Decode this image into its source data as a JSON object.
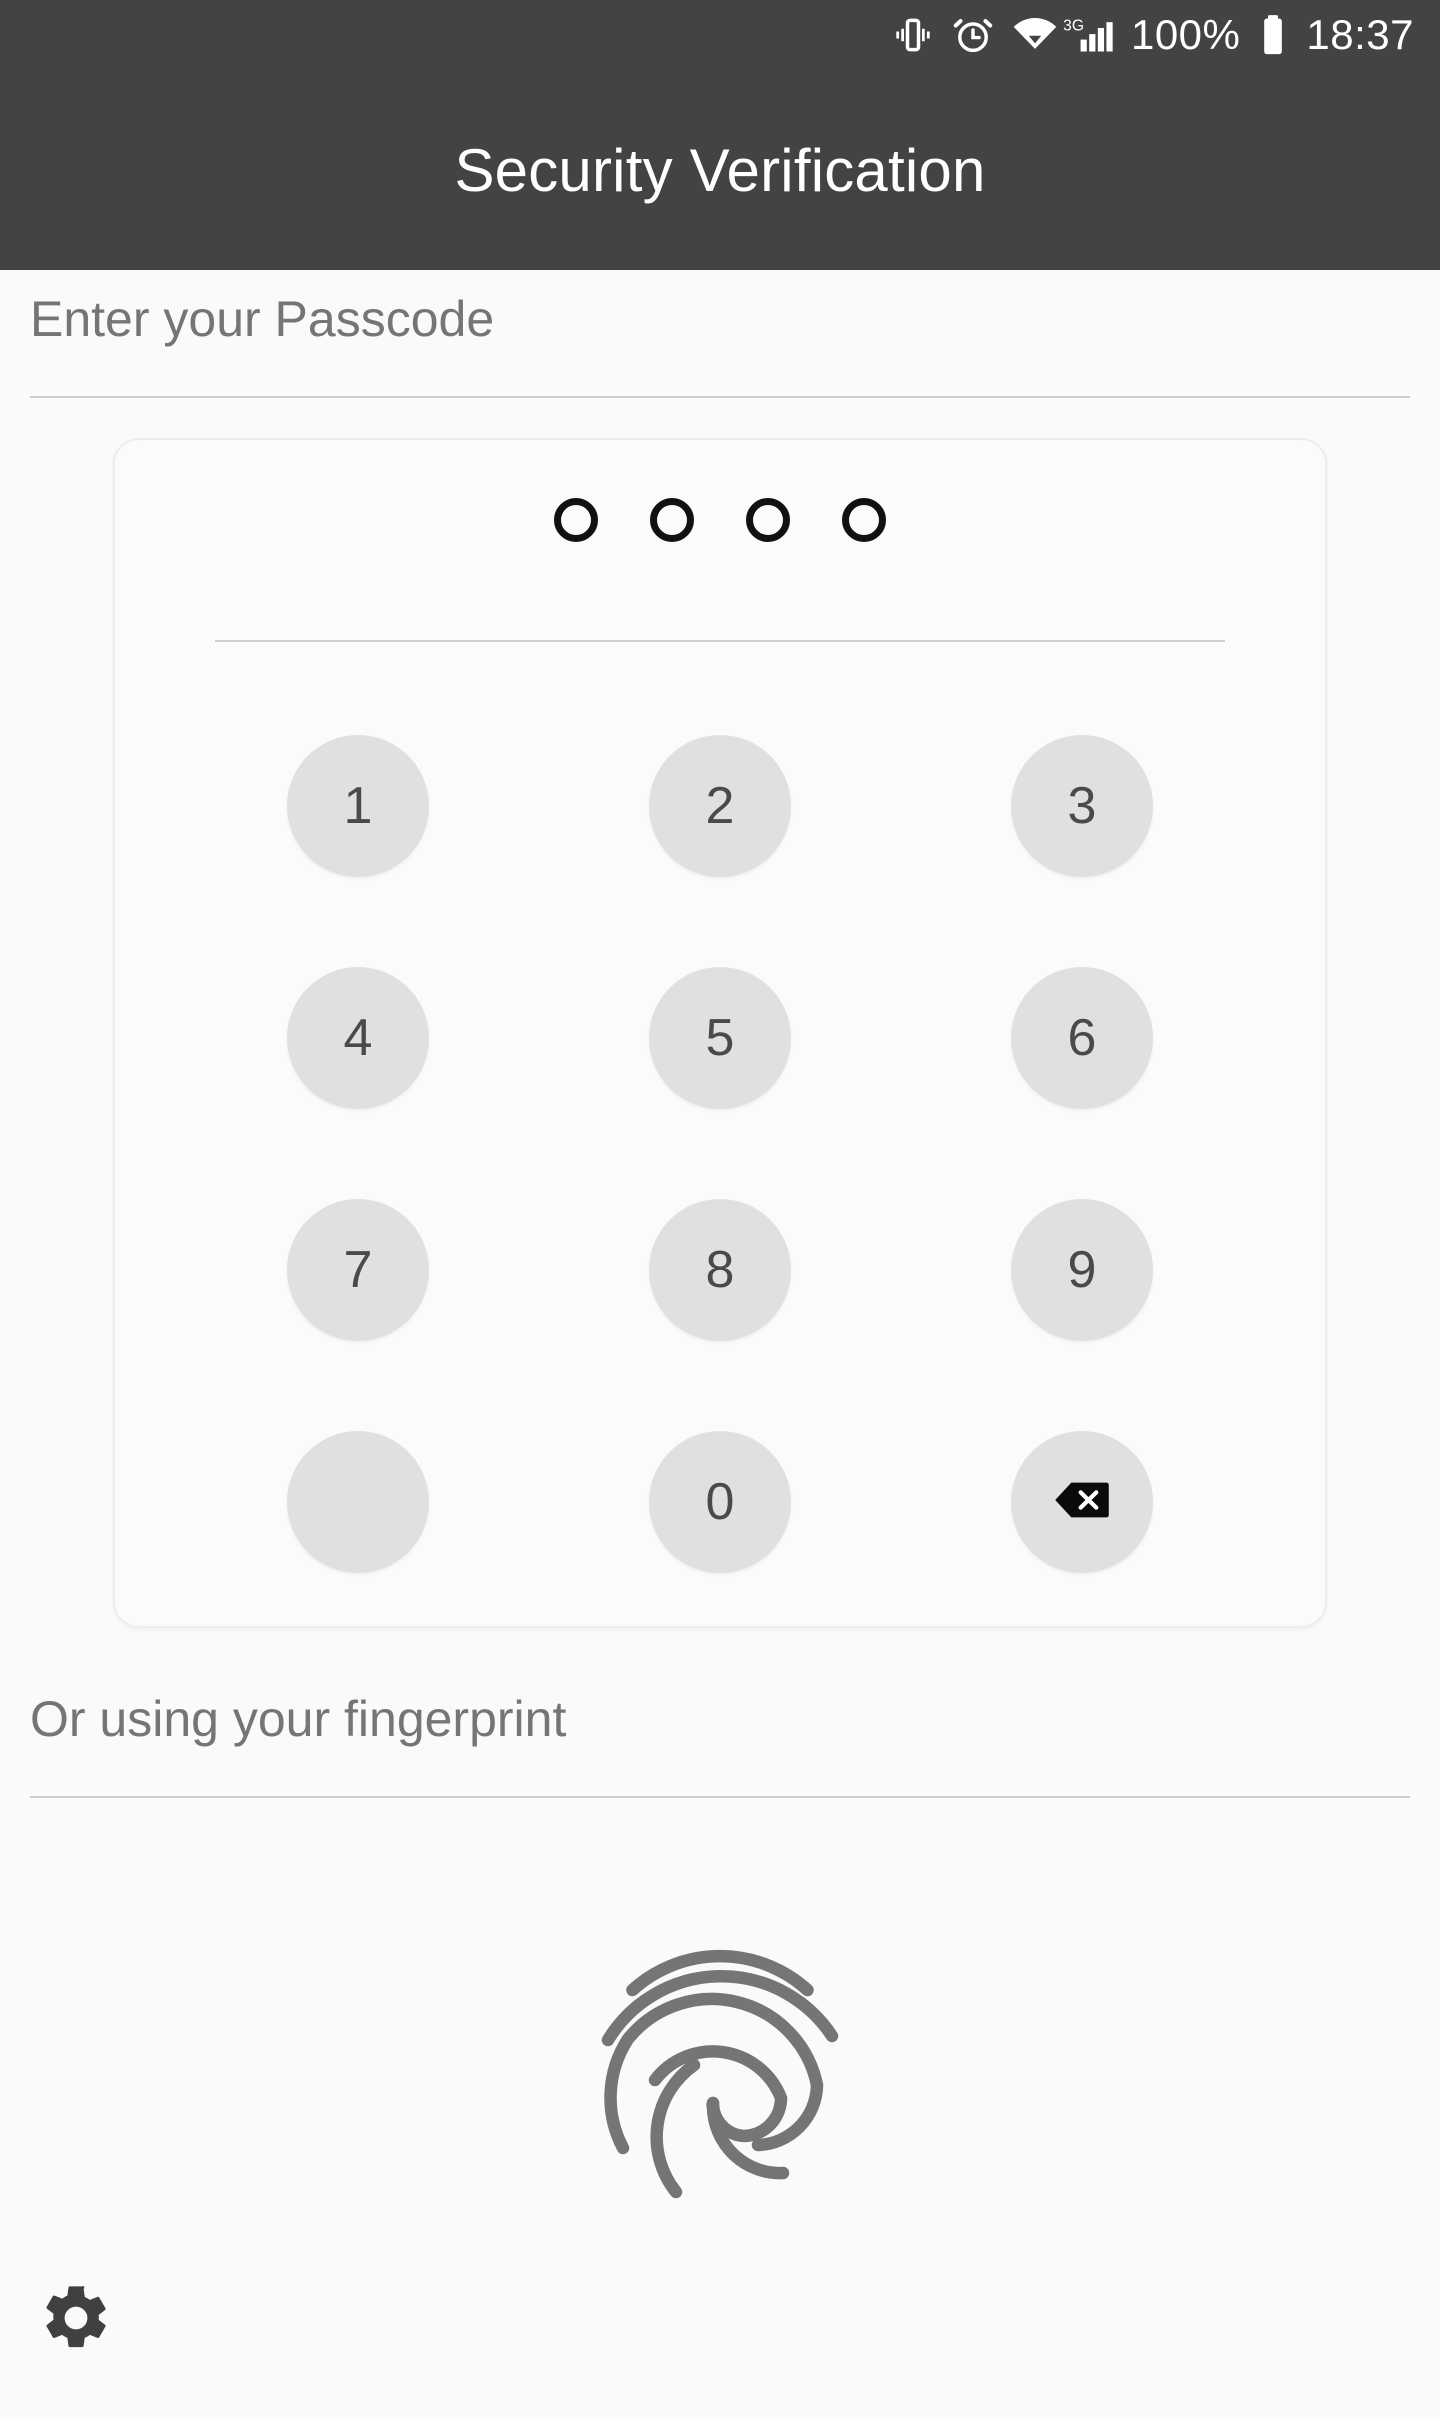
{
  "status_bar": {
    "vibrate_icon": "vibrate-icon",
    "alarm_icon": "alarm-clock-icon",
    "wifi_icon": "wifi-icon",
    "network_type": "3G",
    "signal_icon": "cellular-signal-icon",
    "battery_percent": "100%",
    "battery_icon": "battery-full-icon",
    "clock": "18:37",
    "background_color": "#434343",
    "foreground_color": "#ffffff"
  },
  "app_bar": {
    "title": "Security Verification",
    "background_color": "#434343",
    "title_color": "#ffffff"
  },
  "passcode_section": {
    "label": "Enter your Passcode",
    "label_color": "#757575",
    "dot_count": 4,
    "dots_filled": 0,
    "dot_border_color": "#111111"
  },
  "keypad": {
    "key_background": "#e0e0e0",
    "key_text_color": "#4a4a4a",
    "rows": [
      [
        {
          "label": "1",
          "name": "keypad-key-1",
          "type": "digit"
        },
        {
          "label": "2",
          "name": "keypad-key-2",
          "type": "digit"
        },
        {
          "label": "3",
          "name": "keypad-key-3",
          "type": "digit"
        }
      ],
      [
        {
          "label": "4",
          "name": "keypad-key-4",
          "type": "digit"
        },
        {
          "label": "5",
          "name": "keypad-key-5",
          "type": "digit"
        },
        {
          "label": "6",
          "name": "keypad-key-6",
          "type": "digit"
        }
      ],
      [
        {
          "label": "7",
          "name": "keypad-key-7",
          "type": "digit"
        },
        {
          "label": "8",
          "name": "keypad-key-8",
          "type": "digit"
        },
        {
          "label": "9",
          "name": "keypad-key-9",
          "type": "digit"
        }
      ],
      [
        {
          "label": "",
          "name": "keypad-key-blank",
          "type": "blank"
        },
        {
          "label": "0",
          "name": "keypad-key-0",
          "type": "digit"
        },
        {
          "label": "",
          "name": "keypad-key-backspace",
          "type": "backspace",
          "icon": "backspace-icon"
        }
      ]
    ]
  },
  "fingerprint_section": {
    "label": "Or using your fingerprint",
    "label_color": "#757575",
    "icon": "fingerprint-icon",
    "icon_color": "#757575"
  },
  "footer": {
    "settings_icon": "gear-icon",
    "settings_icon_color": "#404040"
  }
}
